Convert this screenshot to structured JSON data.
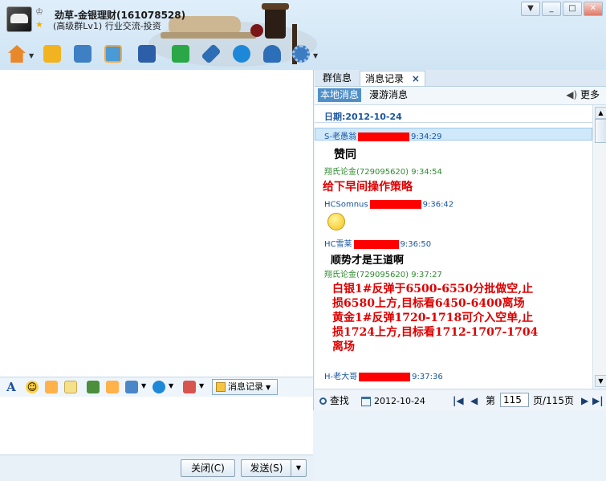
{
  "window": {
    "title": "劲草-金银理财(161078528)",
    "subtitle": "(高级群Lv1) 行业交流-投资",
    "controls": [
      "▼",
      "_",
      "□",
      "✕"
    ]
  },
  "toolbar_icons": [
    "home-icon",
    "folder-icon",
    "notes-icon",
    "album-icon",
    "app-icon",
    "group-office-icon",
    "tools-icon",
    "qzone-icon",
    "settings-icon",
    "gear-icon"
  ],
  "input_toolbar": {
    "font_glyph": "A",
    "message_record_label": "消息记录"
  },
  "bottom": {
    "close_label": "关闭(C)",
    "send_label": "发送(S)"
  },
  "right_tabs": {
    "group_info": "群信息",
    "message_record": "消息记录",
    "close_glyph": "×"
  },
  "subtabs": {
    "local": "本地消息",
    "roam": "漫游消息",
    "more": "更多"
  },
  "date_header": "日期:2012-10-24",
  "messages": [
    {
      "sender": "S-老愚翁",
      "time": "9:34:29",
      "text": "赞同",
      "sender_color": "#1a56a0",
      "text_color": "#000000"
    },
    {
      "sender": "翔氏论金(729095620)",
      "time": "9:34:54",
      "text": "给下早间操作策略",
      "sender_color": "#2e8b2e",
      "text_color": "#dd0000"
    },
    {
      "sender": "HCSomnus",
      "time": "9:36:42",
      "text": "",
      "sender_color": "#1a56a0",
      "text_color": "#000000"
    },
    {
      "sender": "HC雪莱",
      "time": "9:36:50",
      "text": "顺势才是王道啊",
      "sender_color": "#1a56a0",
      "text_color": "#000000"
    },
    {
      "sender": "翔氏论金(729095620)",
      "time": "9:37:27",
      "text_lines": [
        "白银1#反弹于6500-6550分批做空,止",
        "损6580上方,目标看6450-6400离场",
        "黄金1#反弹1720-1718可介入空单,止",
        "损1724上方,目标看1712-1707-1704",
        "离场"
      ],
      "sender_color": "#2e8b2e",
      "text_color": "#dd0000"
    },
    {
      "sender": "H-老大哥",
      "time": "9:37:36",
      "text": "",
      "sender_color": "#1a56a0",
      "text_color": "#000000"
    }
  ],
  "pager": {
    "search_label": "查找",
    "date": "2012-10-24",
    "page_prefix": "第",
    "page_value": "115",
    "page_suffix": "页/115页"
  }
}
